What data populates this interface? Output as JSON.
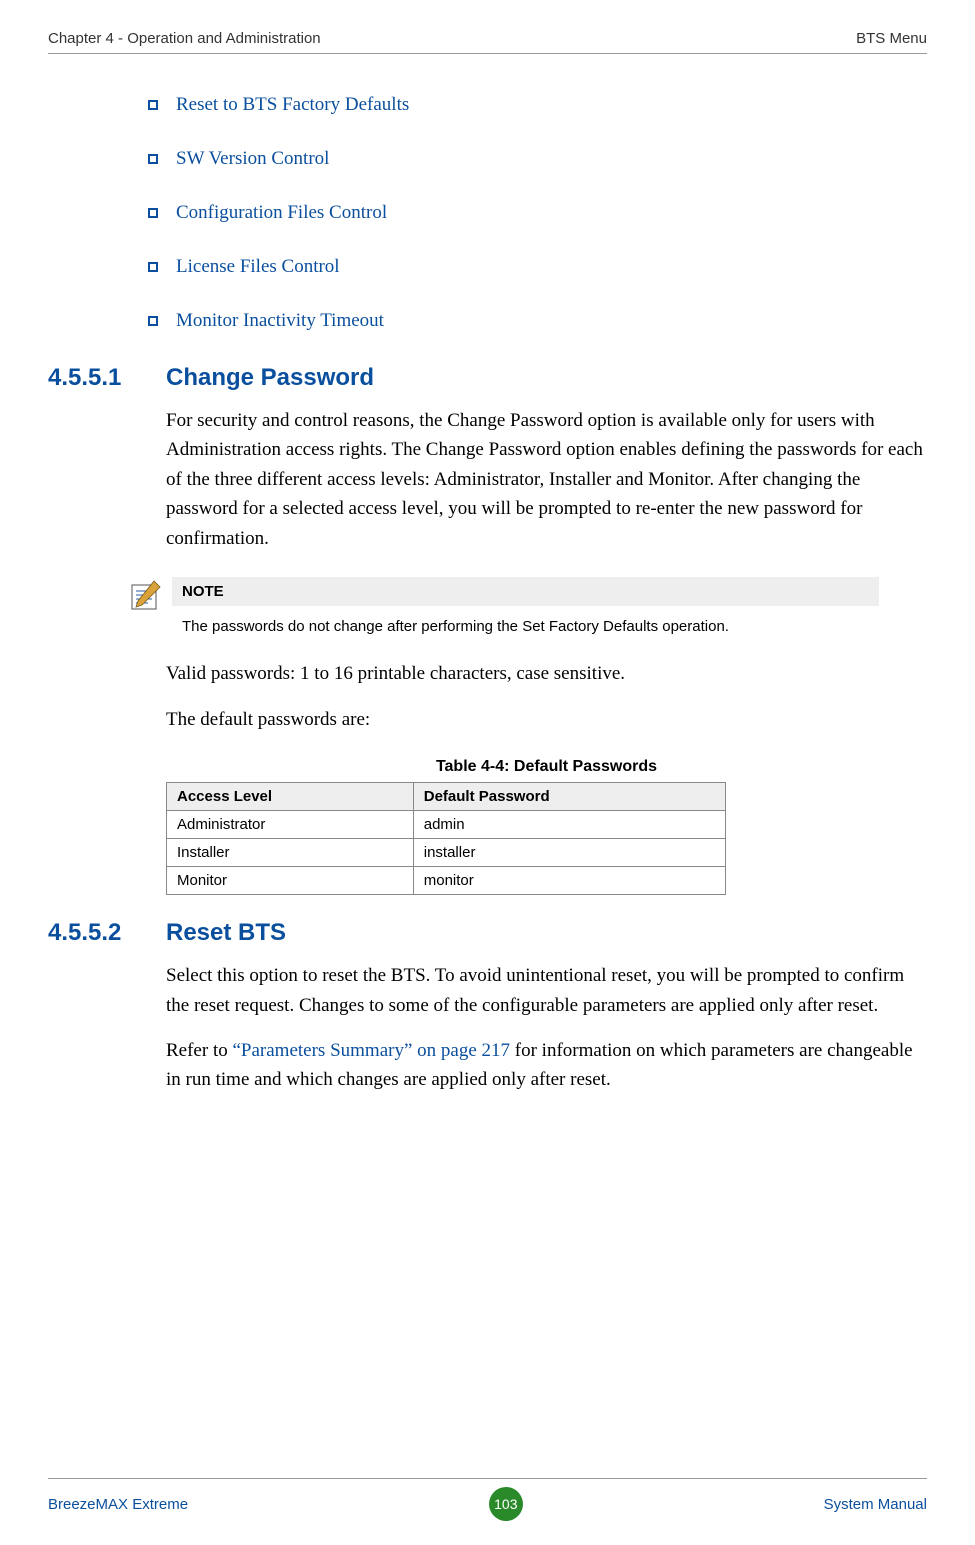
{
  "header": {
    "left": "Chapter 4 - Operation and Administration",
    "right": "BTS Menu"
  },
  "bullets": [
    "Reset to BTS Factory Defaults",
    "SW Version Control",
    "Configuration Files Control",
    "License Files Control",
    "Monitor Inactivity Timeout"
  ],
  "section1": {
    "number": "4.5.5.1",
    "title": "Change Password",
    "para1": "For security and control reasons, the Change Password option is available only for users with Administration access rights. The Change Password option enables defining the passwords for each of the three different access levels: Administrator, Installer and Monitor. After changing the password for a selected access level, you will be prompted to re-enter the new password for confirmation.",
    "para2": "Valid passwords: 1 to 16 printable characters, case sensitive.",
    "para3": "The default passwords are:"
  },
  "note": {
    "label": "NOTE",
    "body": "The passwords do not change after performing the Set Factory Defaults operation."
  },
  "table": {
    "caption": "Table 4-4: Default Passwords",
    "headers": [
      "Access Level",
      "Default Password"
    ],
    "rows": [
      [
        "Administrator",
        "admin"
      ],
      [
        "Installer",
        "installer"
      ],
      [
        "Monitor",
        "monitor"
      ]
    ]
  },
  "section2": {
    "number": "4.5.5.2",
    "title": "Reset BTS",
    "para1": "Select this option to reset the BTS. To avoid unintentional reset, you will be prompted to confirm the reset request. Changes to some of the configurable parameters are applied only after reset.",
    "para2_prefix": "Refer to ",
    "para2_link": "“Parameters Summary” on page 217",
    "para2_suffix": " for information on which parameters are changeable in run time and which changes are applied only after reset."
  },
  "footer": {
    "left": "BreezeMAX Extreme",
    "page": "103",
    "right": "System Manual"
  }
}
